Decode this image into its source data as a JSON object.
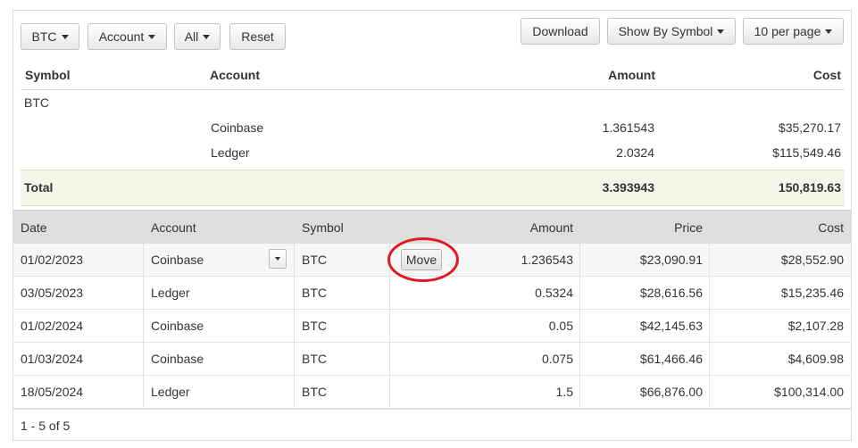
{
  "toolbar": {
    "symbol_filter": "BTC",
    "account_filter": "Account",
    "range_filter": "All",
    "reset_label": "Reset",
    "download_label": "Download",
    "group_by_label": "Show By Symbol",
    "page_size_label": "10 per page"
  },
  "summary": {
    "headers": {
      "symbol": "Symbol",
      "account": "Account",
      "amount": "Amount",
      "cost": "Cost"
    },
    "group_symbol": "BTC",
    "rows": [
      {
        "account": "Coinbase",
        "amount": "1.361543",
        "cost": "$35,270.17"
      },
      {
        "account": "Ledger",
        "amount": "2.0324",
        "cost": "$115,549.46"
      }
    ],
    "total": {
      "label": "Total",
      "amount": "3.393943",
      "cost": "150,819.63"
    }
  },
  "transactions": {
    "headers": {
      "date": "Date",
      "account": "Account",
      "symbol": "Symbol",
      "amount": "Amount",
      "price": "Price",
      "cost": "Cost"
    },
    "move_label": "Move",
    "rows": [
      {
        "date": "01/02/2023",
        "account": "Coinbase",
        "symbol": "BTC",
        "amount": "1.236543",
        "price": "$23,090.91",
        "cost": "$28,552.90"
      },
      {
        "date": "03/05/2023",
        "account": "Ledger",
        "symbol": "BTC",
        "amount": "0.5324",
        "price": "$28,616.56",
        "cost": "$15,235.46"
      },
      {
        "date": "01/02/2024",
        "account": "Coinbase",
        "symbol": "BTC",
        "amount": "0.05",
        "price": "$42,145.63",
        "cost": "$2,107.28"
      },
      {
        "date": "01/03/2024",
        "account": "Coinbase",
        "symbol": "BTC",
        "amount": "0.075",
        "price": "$61,466.46",
        "cost": "$4,609.98"
      },
      {
        "date": "18/05/2024",
        "account": "Ledger",
        "symbol": "BTC",
        "amount": "1.5",
        "price": "$66,876.00",
        "cost": "$100,314.00"
      }
    ]
  },
  "pagination": {
    "summary": "1 - 5 of 5"
  },
  "colors": {
    "highlight_ring": "#e0191f",
    "total_row_bg": "#f4f6e8",
    "grid_header_bg": "#dedede"
  }
}
